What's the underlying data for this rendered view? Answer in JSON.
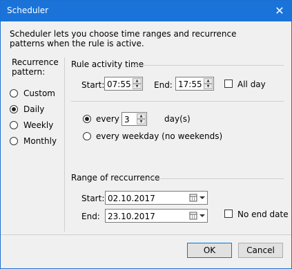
{
  "window": {
    "title": "Scheduler"
  },
  "description": "Scheduler lets you choose time ranges and recurrence patterns when the rule is active.",
  "recurrence": {
    "label": "Recurrence pattern:",
    "options": [
      {
        "label": "Custom",
        "checked": false
      },
      {
        "label": "Daily",
        "checked": true
      },
      {
        "label": "Weekly",
        "checked": false
      },
      {
        "label": "Monthly",
        "checked": false
      }
    ]
  },
  "activity": {
    "label": "Rule activity time",
    "start_label": "Start:",
    "start_value": "07:55",
    "end_label": "End:",
    "end_value": "17:55",
    "allday_label": "All day"
  },
  "daily": {
    "every_label": "every",
    "every_value": "3",
    "days_label": "day(s)",
    "weekday_label": "every weekday (no weekends)"
  },
  "range": {
    "label": "Range of reccurrence",
    "start_label": "Start:",
    "start_value": "02.10.2017",
    "end_label": "End:",
    "end_value": "23.10.2017",
    "noend_label": "No end date"
  },
  "buttons": {
    "ok": "OK",
    "cancel": "Cancel"
  }
}
